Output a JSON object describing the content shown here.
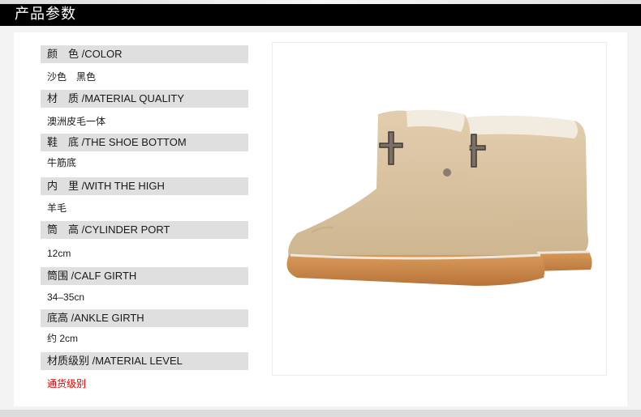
{
  "header": {
    "title": "产品参数"
  },
  "specs": [
    {
      "label": "颜　色 /COLOR",
      "value": "沙色　黑色",
      "red": false
    },
    {
      "label": "材　质 /MATERIAL QUALITY",
      "value": "澳洲皮毛一体",
      "red": false
    },
    {
      "label": "鞋　底 /THE SHOE BOTTOM",
      "value": "牛筋底",
      "red": false
    },
    {
      "label": "内　里 /WITH THE HIGH",
      "value": "羊毛",
      "red": false
    },
    {
      "label": "筒　高 /CYLINDER PORT",
      "value": "12cm",
      "red": false
    },
    {
      "label": "筒围 /CALF GIRTH",
      "value": "34–35cn",
      "red": false
    },
    {
      "label": "底高 /ANKLE GIRTH",
      "value": "约 2cm",
      "red": false
    },
    {
      "label": "材质级别 /MATERIAL LEVEL",
      "value": "通货级别",
      "red": true
    }
  ],
  "photo": {
    "subject": "sand suede ankle boots with cross charm"
  },
  "colors": {
    "header_bg": "#000000",
    "label_bg": "#dfdfdf",
    "accent_red": "#e00000",
    "boot_suede": "#d9c3a3",
    "boot_sole": "#c9864a"
  }
}
